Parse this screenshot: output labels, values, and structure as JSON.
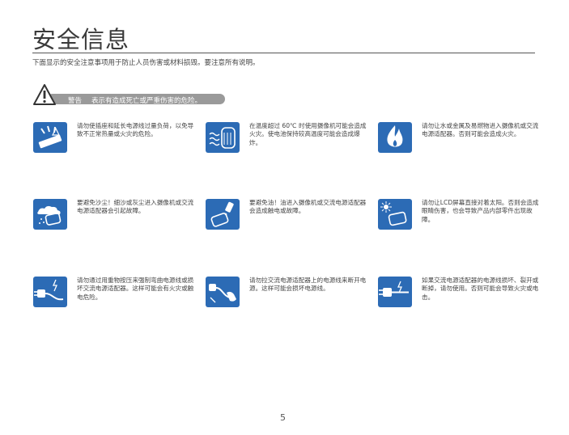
{
  "title": "安全信息",
  "intro": "下面显示的安全注意事项用于防止人员伤害或材料损毁。要注意所有说明。",
  "warning": {
    "label": "警告",
    "text": "表示有造成死亡或严重伤害的危险。"
  },
  "items": [
    {
      "icon": "overloaded-outlet-icon",
      "text": "请勿使插座和延长电源线过量负荷，以免导致不正常热量或火灾的危险。"
    },
    {
      "icon": "heated-battery-icon",
      "text": "在温度超过 60℃ 时使用摄像机可能会造成火灾。使电池保持较高温度可能会造成爆炸。"
    },
    {
      "icon": "fire-icon",
      "text": "请勿让水或金属及易燃物进入摄像机或交流电源适配器。否则可能会造成火灾。"
    },
    {
      "icon": "sand-dust-icon",
      "text": "要避免沙尘！细沙或灰尘进入摄像机或交流电源适配器会引起故障。"
    },
    {
      "icon": "oil-drop-icon",
      "text": "要避免油！油进入摄像机或交流电源适配器会造成触电或故障。"
    },
    {
      "icon": "sunlight-lcd-icon",
      "text": "请勿让LCD屏幕直接对着太阳。否则会造成眼睛伤害，也会导致产品内部零件出现故障。"
    },
    {
      "icon": "bent-cord-icon",
      "text": "请勿通过用重物按压来强制弯曲电源线或损坏交流电源适配器。这样可能会有火灾或触电危险。"
    },
    {
      "icon": "pull-cord-icon",
      "text": "请勿拉交流电源适配器上的电源线来断开电源。这样可能会损坏电源线。"
    },
    {
      "icon": "damaged-plug-icon",
      "text": "如果交流电源适配器的电源线损坏、裂开或断掉，请勿使用。否则可能会导致火灾或电击。"
    }
  ],
  "page_number": "5"
}
